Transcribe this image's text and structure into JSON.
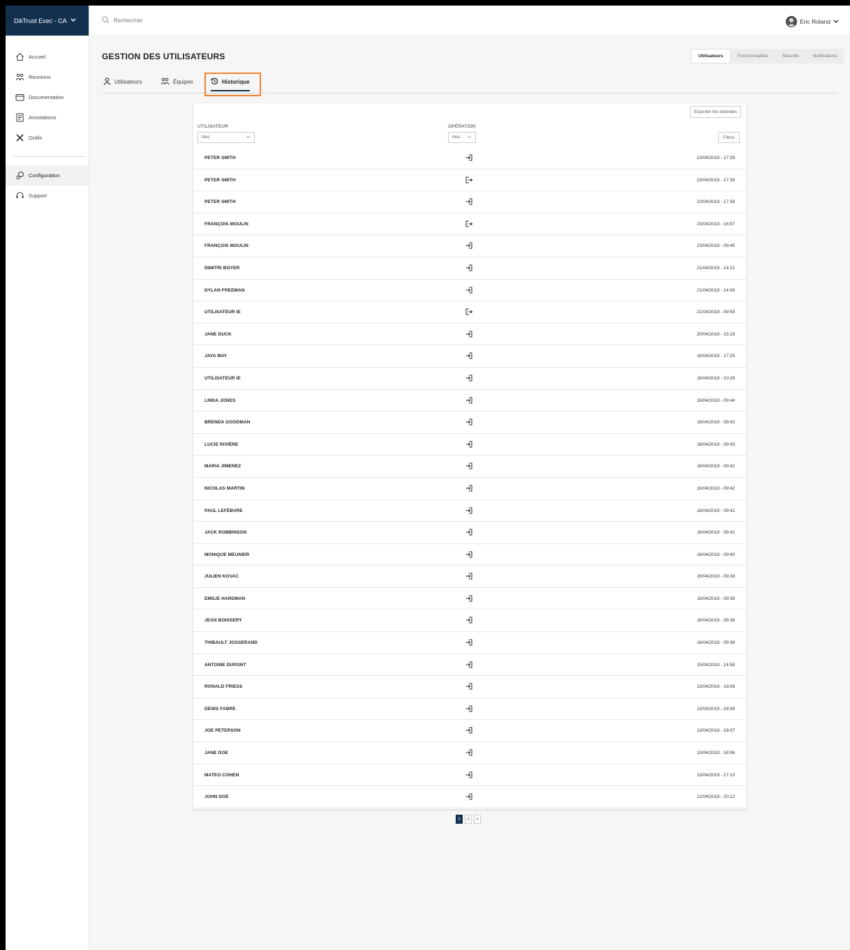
{
  "brand": {
    "label": "DiliTrust Exec - CA"
  },
  "search": {
    "placeholder": "Rechercher"
  },
  "user": {
    "name": "Eric Roland"
  },
  "sidebar": {
    "items": [
      {
        "label": "Accueil",
        "icon": "home-icon"
      },
      {
        "label": "Reunions",
        "icon": "people-icon"
      },
      {
        "label": "Documentation",
        "icon": "folder-icon"
      },
      {
        "label": "Annotations",
        "icon": "notes-icon"
      },
      {
        "label": "Outils",
        "icon": "tools-icon"
      }
    ],
    "bottom_items": [
      {
        "label": "Configuration",
        "icon": "gears-icon",
        "active": true
      },
      {
        "label": "Support",
        "icon": "headset-icon"
      }
    ]
  },
  "page": {
    "title": "GESTION DES UTILISATEURS"
  },
  "right_tabs": [
    {
      "label": "Utilisateurs",
      "active": true
    },
    {
      "label": "Fonctionnalités"
    },
    {
      "label": "Sécurité"
    },
    {
      "label": "Notifications"
    }
  ],
  "subtabs": [
    {
      "label": "Utilisateurs",
      "icon": "user-icon"
    },
    {
      "label": "Équipes",
      "icon": "team-icon"
    },
    {
      "label": "Historique",
      "icon": "history-icon",
      "active": true
    }
  ],
  "table": {
    "export_label": "Exporter les données",
    "col_user": "UTILISATEUR",
    "col_operation": "OPÉRATION",
    "user_filter_value": "tous",
    "operation_filter_value": "tous",
    "filter_label": "Filtrer",
    "rows": [
      {
        "name": "PETER SMITH",
        "op": "login",
        "date": "23/04/2018 - 17:39"
      },
      {
        "name": "PETER SMITH",
        "op": "logout",
        "date": "23/04/2018 - 17:39"
      },
      {
        "name": "PETER SMITH",
        "op": "login",
        "date": "23/04/2018 - 17:38"
      },
      {
        "name": "FRANÇOIS MOULIN",
        "op": "logout",
        "date": "23/04/2018 - 16:57"
      },
      {
        "name": "FRANÇOIS MOULIN",
        "op": "login",
        "date": "23/04/2018 - 09:45"
      },
      {
        "name": "DIMITRI BOYER",
        "op": "login",
        "date": "21/04/2018 - 14:21"
      },
      {
        "name": "DYLAN FREEMAN",
        "op": "login",
        "date": "21/04/2018 - 14:08"
      },
      {
        "name": "UTILISATEUR IE",
        "op": "logout",
        "date": "21/04/2018 - 09:59"
      },
      {
        "name": "JANE DUCK",
        "op": "login",
        "date": "20/04/2018 - 15:18"
      },
      {
        "name": "JAYA MAY",
        "op": "login",
        "date": "16/04/2018 - 17:25"
      },
      {
        "name": "UTILISATEUR IE",
        "op": "login",
        "date": "16/04/2018 - 10:29"
      },
      {
        "name": "LINDA JONES",
        "op": "login",
        "date": "16/04/2018 - 09:44"
      },
      {
        "name": "BRENDA GOODMAN",
        "op": "login",
        "date": "16/04/2018 - 09:43"
      },
      {
        "name": "LUCIE RIVIÈRE",
        "op": "login",
        "date": "16/04/2018 - 09:43"
      },
      {
        "name": "MARIA JIMENEZ",
        "op": "login",
        "date": "16/04/2018 - 09:42"
      },
      {
        "name": "NICOLAS MARTIN",
        "op": "login",
        "date": "16/04/2018 - 09:42"
      },
      {
        "name": "PAUL LEFÈBVRE",
        "op": "login",
        "date": "16/04/2018 - 09:41"
      },
      {
        "name": "JACK ROBBINSON",
        "op": "login",
        "date": "16/04/2018 - 09:41"
      },
      {
        "name": "MONIQUE MEUNIER",
        "op": "login",
        "date": "16/04/2018 - 09:40"
      },
      {
        "name": "JULIEN KOVAC",
        "op": "login",
        "date": "16/04/2018 - 09:39"
      },
      {
        "name": "EMILIE HARDMAN",
        "op": "login",
        "date": "16/04/2018 - 09:39"
      },
      {
        "name": "JEAN BOISSERY",
        "op": "login",
        "date": "16/04/2018 - 09:38"
      },
      {
        "name": "THIBAULT JOSSERAND",
        "op": "login",
        "date": "16/04/2018 - 09:38"
      },
      {
        "name": "ANTOINE DUPONT",
        "op": "login",
        "date": "15/04/2018 - 14:58"
      },
      {
        "name": "RONALD FRIESS",
        "op": "login",
        "date": "13/04/2018 - 18:08"
      },
      {
        "name": "DENIS FABRE",
        "op": "login",
        "date": "13/04/2018 - 18:08"
      },
      {
        "name": "JOE PETERSON",
        "op": "login",
        "date": "13/04/2018 - 18:07"
      },
      {
        "name": "JANE DOE",
        "op": "login",
        "date": "13/04/2018 - 18:06"
      },
      {
        "name": "MATEO COHEN",
        "op": "login",
        "date": "13/04/2018 - 17:10"
      },
      {
        "name": "JOHN DOE",
        "op": "login",
        "date": "12/04/2018 - 20:12"
      }
    ]
  },
  "pagination": {
    "pages": [
      "1",
      "2"
    ],
    "next": ">",
    "current": "1"
  },
  "colors": {
    "brand": "#14304f",
    "highlight": "#f2822f"
  }
}
